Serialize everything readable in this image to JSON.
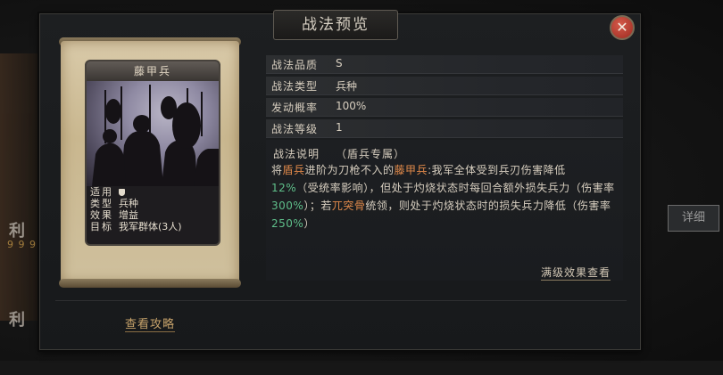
{
  "background": {
    "left_marks": [
      "利",
      "利"
    ],
    "digits": "9 9 9",
    "detail_button": "详细"
  },
  "dialog": {
    "title": "战法预览",
    "close_symbol": "✕",
    "card": {
      "name": "藤甲兵",
      "rows": [
        {
          "key": "适用",
          "value": ""
        },
        {
          "key": "类型",
          "value": "兵种"
        },
        {
          "key": "效果",
          "value": "增益"
        },
        {
          "key": "目标",
          "value": "我军群体(3人)"
        }
      ]
    },
    "guide_link": "查看攻略",
    "attributes": [
      {
        "label": "战法品质",
        "value": "S"
      },
      {
        "label": "战法类型",
        "value": "兵种"
      },
      {
        "label": "发动概率",
        "value": "100%"
      },
      {
        "label": "战法等级",
        "value": "1"
      }
    ],
    "description": {
      "label": "战法说明",
      "sub": "（盾兵专属）",
      "parts": {
        "p1": "将",
        "p2": "盾兵",
        "p3": "进阶为刀枪不入的",
        "p4": "藤甲兵",
        "p5": ":我军全体受到兵刃伤害降低",
        "p6": "12%",
        "p7": "（受统率影响），但处于灼烧状态时每回合额外损失兵力（伤害率",
        "p8": "300%",
        "p9": "）；若",
        "p10": "兀突骨",
        "p11": "统领，则处于灼烧状态时的损失兵力降低（伤害率",
        "p12": "250%",
        "p13": "）"
      }
    },
    "full_effect_link": "满级效果查看"
  },
  "colors": {
    "highlight_orange": "#e0894a",
    "highlight_green": "#5fbf8a",
    "close_red": "#b83a2c"
  }
}
